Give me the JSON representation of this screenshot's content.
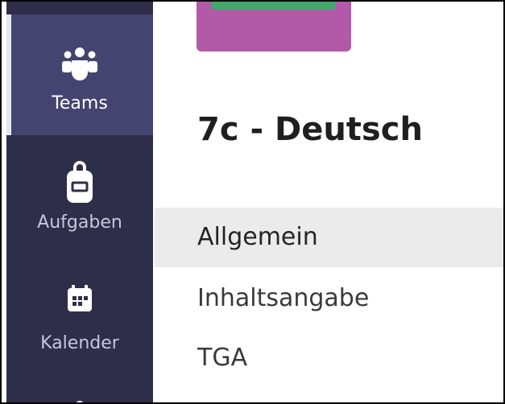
{
  "rail": {
    "items": [
      {
        "label": "Teams",
        "icon": "teams-icon",
        "active": true
      },
      {
        "label": "Aufgaben",
        "icon": "assignments-icon",
        "active": false
      },
      {
        "label": "Kalender",
        "icon": "calendar-icon",
        "active": false
      }
    ]
  },
  "team": {
    "name": "7c - Deutsch",
    "avatar_color": "#b25aa8"
  },
  "channels": [
    {
      "label": "Allgemein",
      "selected": true
    },
    {
      "label": "Inhaltsangabe",
      "selected": false
    },
    {
      "label": "TGA",
      "selected": false
    }
  ],
  "colors": {
    "rail_bg": "#2f2e4a",
    "rail_active": "#444470",
    "selected_channel_bg": "#ebebeb"
  }
}
